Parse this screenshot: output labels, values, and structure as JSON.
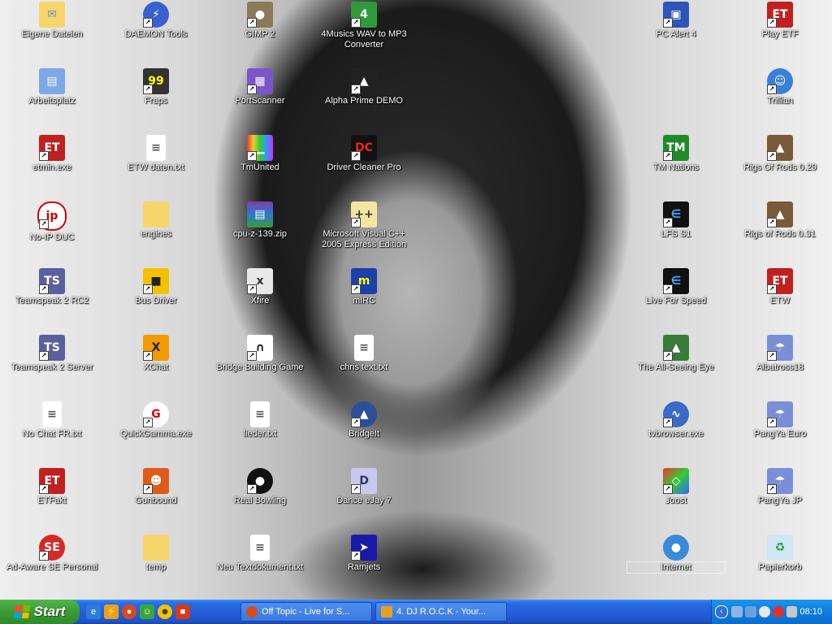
{
  "desktop_icons": {
    "eigene_dateien": "Eigene Dateien",
    "daemon_tools": "DAEMON Tools",
    "gimp2": "GIMP 2",
    "musics_converter": "4Musics WAV to MP3 Converter",
    "pc_alert": "PC Alert 4",
    "play_etf": "Play ETF",
    "arbeitsplatz": "Arbeitsplatz",
    "fraps": "Fraps",
    "portscanner": "PortScanner",
    "alpha_prime": "Alpha Prime DEMO",
    "trillian": "Trillian",
    "etmin": "etmin.exe",
    "etw_daten": "ETW daten.txt",
    "tmunited": "TmUnited",
    "driver_cleaner": "Driver Cleaner Pro",
    "tm_nations": "TM Nations",
    "rigs_029": "Rigs Of Rods 0.29",
    "noip": "No-IP DUC",
    "engines": "engines",
    "cpuz": "cpu-z-139.zip",
    "msvc": "Microsoft Visual C++ 2005 Express Edition",
    "lfs_s1": "LFS S1",
    "rigs_031": "Rigs of Rods 0.31",
    "ts2_rc2": "Teamspeak 2 RC2",
    "bus_driver": "Bus Driver",
    "xfire": "Xfire",
    "mirc": "mIRC",
    "live_for_speed": "Live For Speed",
    "etw": "ETW",
    "ts2_server": "Teamspeak 2 Server",
    "xchat": "XChat",
    "bridge_building": "Bridge Building Game",
    "chris_text": "chris text.txt",
    "all_seeing_eye": "The All-Seeing Eye",
    "albatross": "Albatross18",
    "no_chat": "No Chat FR.txt",
    "quickgamma": "QuickGamma.exe",
    "lieder": "lieder.txt",
    "bridgeit": "BridgeIt",
    "tvbrowser": "tvbrowser.exe",
    "pangya_euro": "PangYa Euro",
    "etfakt": "ETFakt",
    "gunbound": "Gunbound",
    "real_bowling": "Real Bowling",
    "dance_ejay": "Dance eJay 7",
    "joost": "Joost",
    "pangya_jp": "PangYa JP",
    "adaware": "Ad-Aware SE Personal",
    "temp": "temp",
    "neu_text": "Neu Textdokument.txt",
    "ramjets": "Ramjets",
    "internet": "Internet",
    "papierkorb": "Papierkorb"
  },
  "taskbar": {
    "start_label": "Start",
    "tasks": [
      {
        "label": "Off Topic - Live for S...",
        "icon": "browser-icon"
      },
      {
        "label": "4. DJ R.O.C.K - Your...",
        "icon": "winamp-icon"
      }
    ],
    "clock": "08:10"
  },
  "colors": {
    "taskbar_blue": "#245edb",
    "start_green": "#3c9a36",
    "tray_blue": "#0f7ddd"
  }
}
